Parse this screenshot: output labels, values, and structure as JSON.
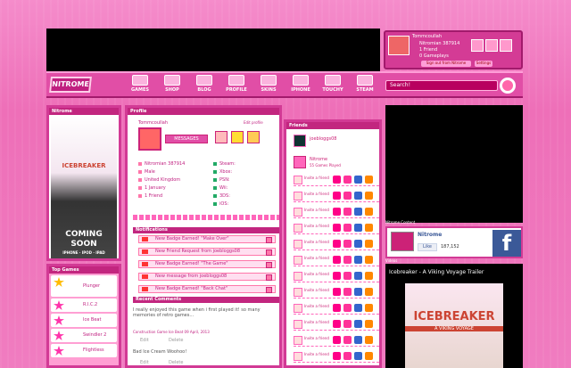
{
  "user": {
    "name": "Tommcoullah",
    "nitromian": "Nitromian 387914",
    "friends": "1 Friend",
    "gameplays": "0 Gameplays",
    "sign_out": "Sign out from Nitrome",
    "settings": "Settings"
  },
  "nav": {
    "logo": "NITROME",
    "items": [
      "GAMES",
      "SHOP",
      "BLOG",
      "PROFILE",
      "SKINS",
      "IPHONE",
      "TOUCHY",
      "STEAM"
    ],
    "search_placeholder": "Search!"
  },
  "left": {
    "header": "Nitrome",
    "game": "ICEBREAKER",
    "coming": "COMING",
    "soon": "SOON",
    "platforms": "IPHONE · IPOD · IPAD"
  },
  "topgames": {
    "header": "Top Games",
    "items": [
      "Plunger",
      "R.I.C.2",
      "Ice Beat",
      "Swindler 2",
      "Flightless"
    ]
  },
  "profile": {
    "header": "Profile",
    "username": "Tommcoullah",
    "edit": "Edit profile",
    "messages": "MESSAGES",
    "rows": [
      "Nitromian 387914",
      "Male",
      "United Kingdom",
      "1 January",
      "1 Friend"
    ],
    "stats": [
      "Steam:",
      "Xbox:",
      "PSN:",
      "Wii:",
      "3DS:",
      "iOS:"
    ]
  },
  "notifications": {
    "header": "Notifications",
    "items": [
      "New Badge Earned! \"Make Over\"",
      "New Friend Request from joebloggs08",
      "New Badge Earned! \"The Game\"",
      "New message from joebloggs08",
      "New Badge Earned! \"Back Chat\""
    ]
  },
  "comments": {
    "header": "Recent Comments",
    "text1": "I really enjoyed this game when i first played it! so many memories of retro games...",
    "meta1": "Construction Game   Ice Beat   09 April, 2013",
    "edit": "Edit",
    "delete": "Delete",
    "text2": "Bad Ice Cream Woohoo!"
  },
  "friends": {
    "header": "Friends",
    "f1": "joebloggs08",
    "f2": "Nitrome",
    "f2sub": "55 Games Played",
    "empty": "Invite a friend"
  },
  "right": {
    "header1": "Nitrome Content",
    "fb_name": "Nitrome",
    "fb_like": "Like",
    "fb_count": "187,152",
    "videos_header": "Videos",
    "video_title": "Icebreaker - A Viking Voyage Trailer",
    "video_logo": "ICEBREAKER",
    "video_sub": "A VIKING VOYAGE"
  }
}
